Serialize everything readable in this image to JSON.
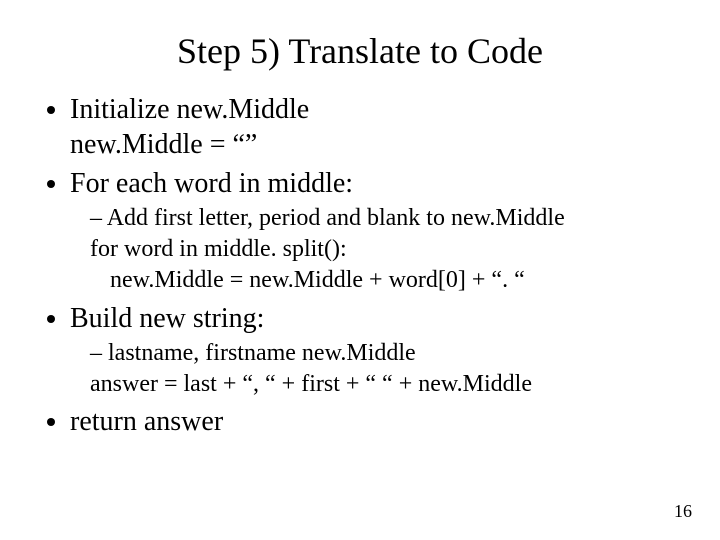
{
  "title": "Step 5) Translate to Code",
  "bullets": {
    "b1": {
      "text": "Initialize new.Middle",
      "sub": "new.Middle = “”"
    },
    "b2": {
      "text": "For each word in middle:",
      "dash": "Add first letter, period and blank to new.Middle",
      "line1": "for word in middle. split():",
      "line2": "new.Middle = new.Middle + word[0] + “. “"
    },
    "b3": {
      "text": "Build new string:",
      "dash": "lastname, firstname new.Middle",
      "line1": "answer = last + “, “ + first + “ “ + new.Middle"
    },
    "b4": {
      "text": "return answer"
    }
  },
  "page_number": "16"
}
